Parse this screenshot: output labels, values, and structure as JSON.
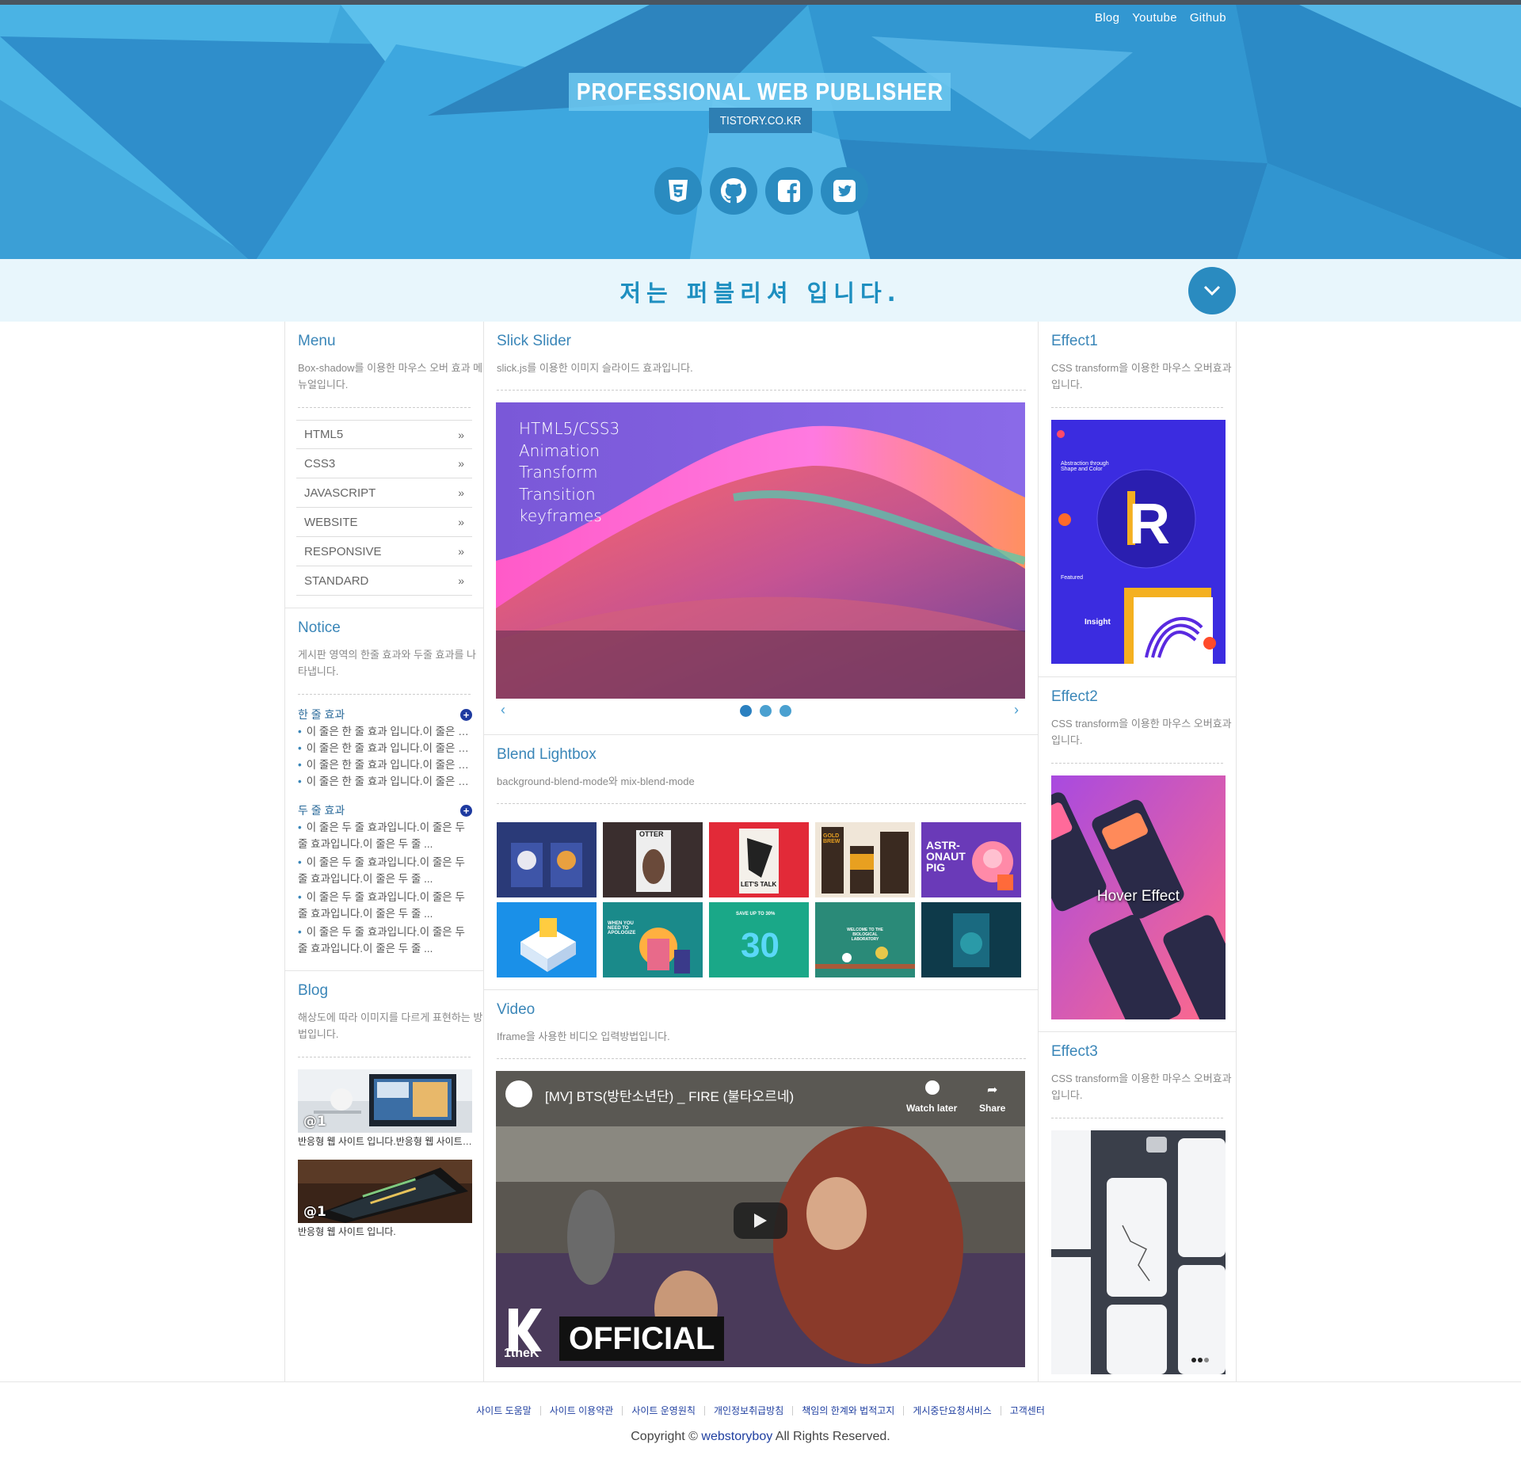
{
  "header": {
    "top_links": [
      "Blog",
      "Youtube",
      "Github"
    ],
    "title": "PROFESSIONAL WEB PUBLISHER",
    "subtitle": "TISTORY.CO.KR",
    "social_icons": [
      "html5-icon",
      "github-icon",
      "facebook-icon",
      "twitter-icon"
    ],
    "accent": "#2a8bc0"
  },
  "tagline": {
    "text": "저는 퍼블리셔 입니다."
  },
  "left": {
    "menu": {
      "title": "Menu",
      "desc": "Box-shadow를 이용한 마우스 오버 효과 메뉴얼입니다.",
      "items": [
        "HTML5",
        "CSS3",
        "JAVASCRIPT",
        "WEBSITE",
        "RESPONSIVE",
        "STANDARD"
      ],
      "arrow": "»"
    },
    "notice": {
      "title": "Notice",
      "desc": "게시판 영역의 한줄 효과와 두줄 효과를 나타냅니다.",
      "one_line_title": "한 줄 효과",
      "one_line_items": [
        "이 줄은 한 줄 효과 입니다.이 줄은 한 줄 효과",
        "이 줄은 한 줄 효과 입니다.이 줄은 한 줄 효과",
        "이 줄은 한 줄 효과 입니다.이 줄은 한 줄 효과",
        "이 줄은 한 줄 효과 입니다.이 줄은 한 줄 효과"
      ],
      "two_line_title": "두 줄 효과",
      "two_line_items": [
        "이 줄은 두 줄 효과입니다.이 줄은 두 줄 효과입니다.이 줄은 두 줄 ...",
        "이 줄은 두 줄 효과입니다.이 줄은 두 줄 효과입니다.이 줄은 두 줄 ...",
        "이 줄은 두 줄 효과입니다.이 줄은 두 줄 효과입니다.이 줄은 두 줄 ...",
        "이 줄은 두 줄 효과입니다.이 줄은 두 줄 효과입니다.이 줄은 두 줄 ..."
      ],
      "plus": "+"
    },
    "blog": {
      "title": "Blog",
      "desc": "해상도에 따라 이미지를 다르게 표현하는 방법입니다.",
      "tag": "@1",
      "captions": [
        "반응형 웹 사이트 입니다.반응형 웹 사이트 입니다.",
        "반응형 웹 사이트 입니다."
      ]
    }
  },
  "center": {
    "slider": {
      "title": "Slick Slider",
      "desc": "slick.js를 이용한 이미지 슬라이드 효과입니다.",
      "words": [
        "HTML5/CSS3",
        "Animation",
        "Transform",
        "Transition",
        "keyframes"
      ],
      "prev": "‹",
      "next": "›"
    },
    "lightbox": {
      "title": "Blend Lightbox",
      "desc": "background-blend-mode와 mix-blend-mode",
      "thumb_texts": [
        "OTTER",
        "LET'S TALK",
        "GOLD BREW",
        "ASTR-ONAUT PIG",
        "WHEN YOU NEED TO APOLOGIZE",
        "SAVE UP TO 30%",
        "30",
        "WELCOME TO THE BIOLOGICAL LABORATORY"
      ]
    },
    "video": {
      "title": "Video",
      "desc": "Iframe을 사용한 비디오 입력방법입니다.",
      "video_title": "[MV] BTS(방탄소년단) _ FIRE (불타오르네)",
      "channel": "1theK",
      "watch_later": "Watch later",
      "share": "Share",
      "badge": "OFFICIAL"
    }
  },
  "right": {
    "effect1": {
      "title": "Effect1",
      "desc": "CSS transform을 이용한 마우스 오버효과입니다.",
      "img_text1": "Abstraction through Shape and Color",
      "img_text2": "Featured",
      "img_text3": "Insight"
    },
    "effect2": {
      "title": "Effect2",
      "desc": "CSS transform을 이용한 마우스 오버효과입니다.",
      "overlay": "Hover Effect"
    },
    "effect3": {
      "title": "Effect3",
      "desc": "CSS transform을 이용한 마우스 오버효과입니다."
    }
  },
  "footer": {
    "links": [
      "사이트 도움말",
      "사이트 이용약관",
      "사이트 운영원칙",
      "개인정보취급방침",
      "책임의 한계와 법적고지",
      "게시중단요청서비스",
      "고객센터"
    ],
    "copy_prefix": "Copyright ©",
    "brand": "webstoryboy",
    "copy_suffix": "All Rights Reserved."
  }
}
